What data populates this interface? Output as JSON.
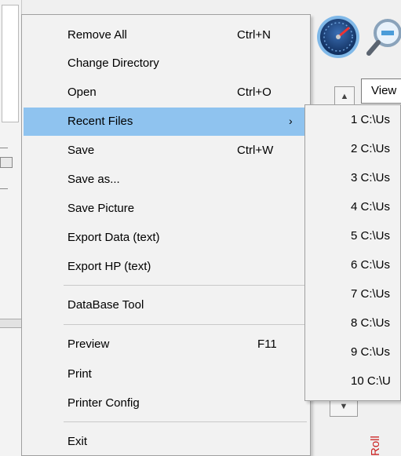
{
  "menu": {
    "items": [
      {
        "label": "Remove All",
        "shortcut": "Ctrl+N"
      },
      {
        "label": "Change Directory",
        "shortcut": ""
      },
      {
        "label": "Open",
        "shortcut": "Ctrl+O"
      },
      {
        "label": "Recent Files",
        "shortcut": "",
        "has_submenu": true,
        "arrow": "›"
      },
      {
        "label": "Save",
        "shortcut": "Ctrl+W"
      },
      {
        "label": "Save as...",
        "shortcut": ""
      },
      {
        "label": "Save Picture",
        "shortcut": ""
      },
      {
        "label": "Export Data (text)",
        "shortcut": ""
      },
      {
        "label": "Export HP (text)",
        "shortcut": ""
      },
      {
        "label": "DataBase Tool",
        "shortcut": ""
      },
      {
        "label": "Preview",
        "shortcut": "F11"
      },
      {
        "label": "Print",
        "shortcut": ""
      },
      {
        "label": "Printer Config",
        "shortcut": ""
      },
      {
        "label": "Exit",
        "shortcut": ""
      }
    ]
  },
  "submenu": {
    "items": [
      {
        "label": "1 C:\\Us"
      },
      {
        "label": "2 C:\\Us"
      },
      {
        "label": "3 C:\\Us"
      },
      {
        "label": "4 C:\\Us"
      },
      {
        "label": "5 C:\\Us"
      },
      {
        "label": "6 C:\\Us"
      },
      {
        "label": "7 C:\\Us"
      },
      {
        "label": "8 C:\\Us"
      },
      {
        "label": "9 C:\\Us"
      },
      {
        "label": "10 C:\\U"
      }
    ]
  },
  "background": {
    "view_label": "View",
    "red_label": "Roll"
  },
  "colors": {
    "highlight": "#8fc3ef",
    "menu_bg": "#f2f2f2",
    "accent_red": "#c22222"
  },
  "icons": {
    "gauge": "speedometer-icon",
    "zoom": "magnifier-icon"
  }
}
